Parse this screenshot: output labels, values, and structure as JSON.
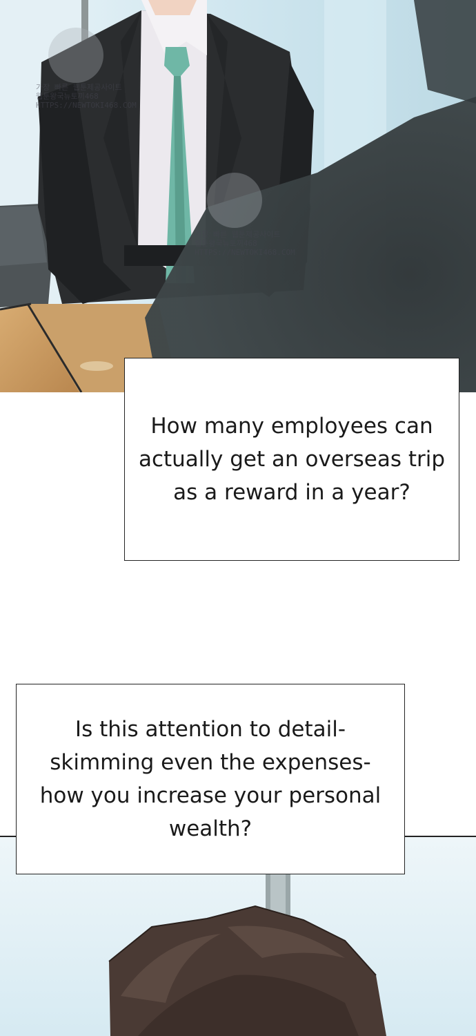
{
  "panels": {
    "top": {
      "watermarks": [
        {
          "text": "가장 빠른 웹툰제공사이트\n웹툰왕국뉴토끼468\nHTTPS://NEWTOKI468.COM"
        },
        {
          "text": "가장 빠른 웹툰제공사이트\n웹툰왕국뉴토끼468\nHTTPS://NEWTOKI468.COM"
        }
      ]
    }
  },
  "dialogue": [
    {
      "text": "How many employees can\nactually get an overseas trip\nas a reward in a year?"
    },
    {
      "text": "Is this attention to detail-\nskimming even the expenses-\nhow you increase your personal\nwealth?"
    }
  ],
  "colors": {
    "suit": "#2b2d2f",
    "shirt": "#ece9ee",
    "tie": "#6fb7a6",
    "desk": "#c79a63",
    "window": "#cfe6ef",
    "hair": "#4a3a34"
  }
}
